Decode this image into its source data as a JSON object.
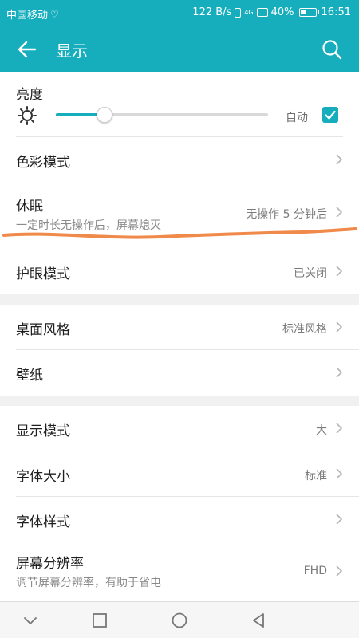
{
  "status_bar": {
    "carrier": "中国移动",
    "net_speed": "122 B/s",
    "net_type": "4G",
    "battery": "40%",
    "battery_level": 0.4,
    "time": "16:51"
  },
  "app_bar": {
    "title": "显示",
    "color": "#16adbd"
  },
  "brightness": {
    "title": "亮度",
    "level": 0.23,
    "auto_label": "自动",
    "auto_checked": true
  },
  "rows": {
    "color_mode": {
      "title": "色彩模式"
    },
    "sleep": {
      "title": "休眠",
      "subtitle": "一定时长无操作后，屏幕熄灭",
      "value": "无操作 5 分钟后"
    },
    "eye_mode": {
      "title": "护眼模式",
      "value": "已关闭"
    },
    "desktop_style": {
      "title": "桌面风格",
      "value": "标准风格"
    },
    "wallpaper": {
      "title": "壁纸"
    },
    "display_mode": {
      "title": "显示模式",
      "value": "大"
    },
    "font_size": {
      "title": "字体大小",
      "value": "标准"
    },
    "font_style": {
      "title": "字体样式"
    },
    "resolution": {
      "title": "屏幕分辨率",
      "subtitle": "调节屏幕分辨率，有助于省电",
      "value": "FHD"
    }
  },
  "annotation_color": "#f08a4b",
  "nav_icons": [
    "chevron-down-icon",
    "square-icon",
    "circle-icon",
    "triangle-back-icon"
  ]
}
